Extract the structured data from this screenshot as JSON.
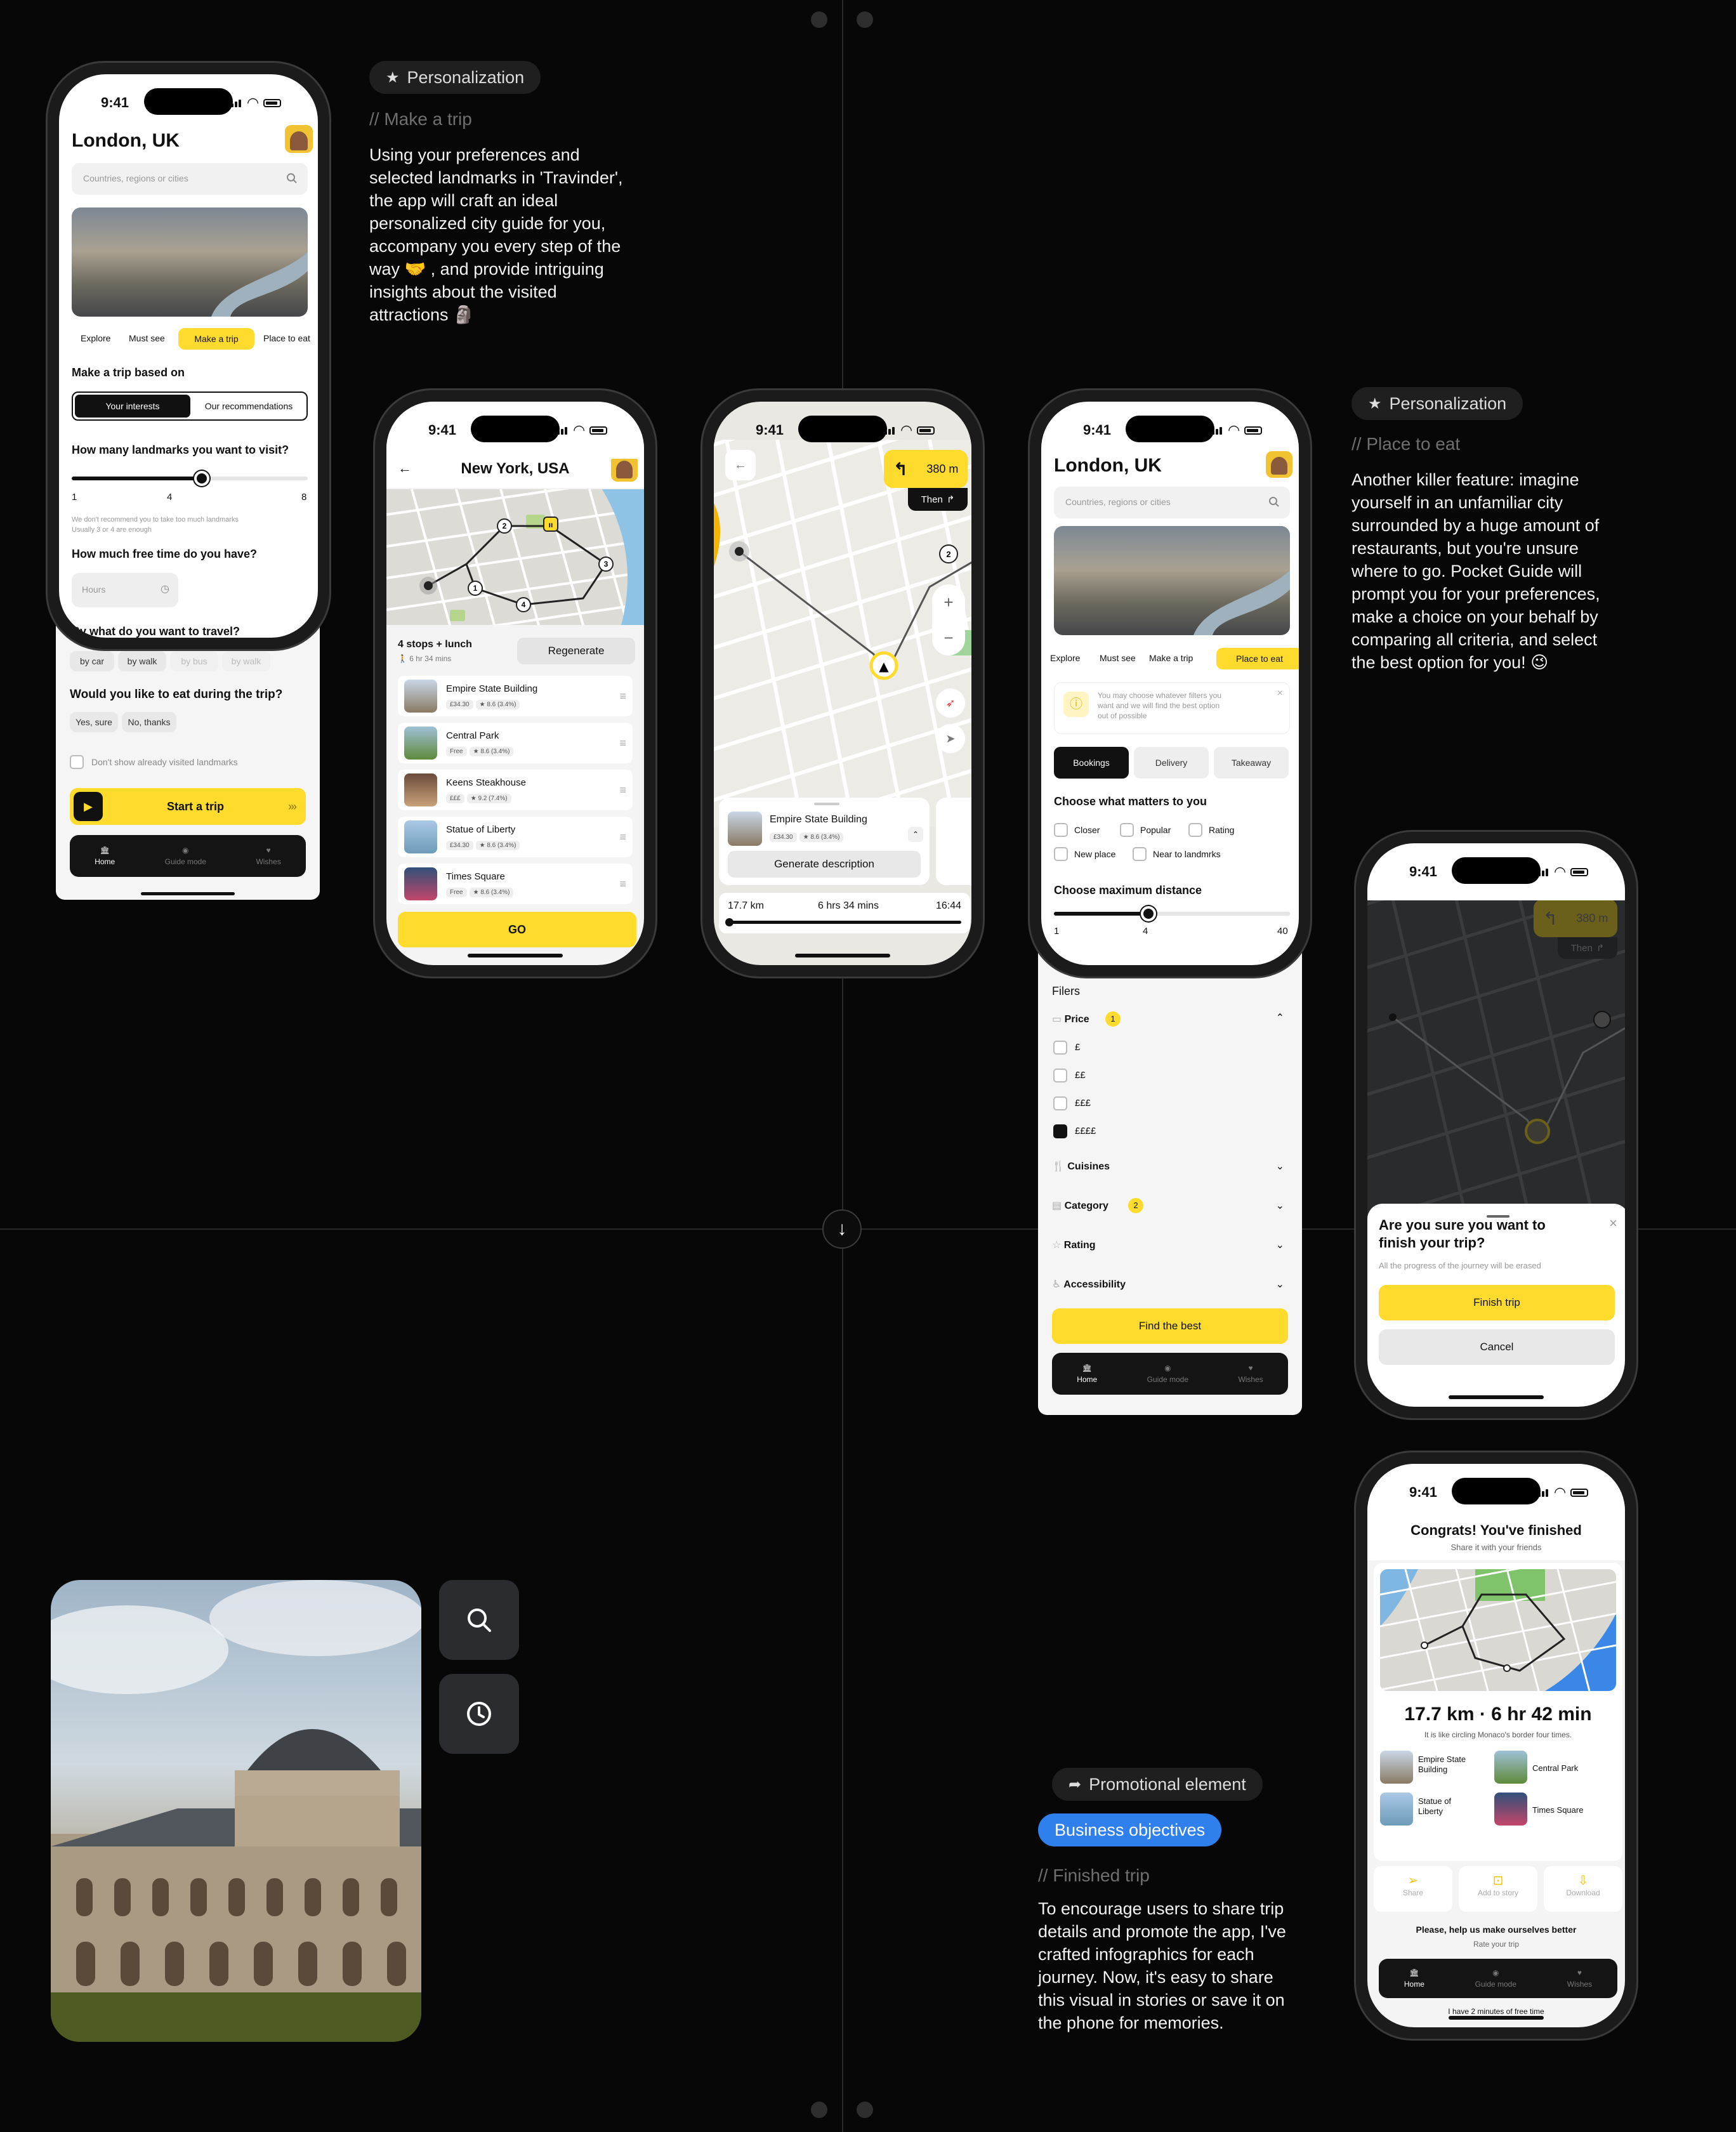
{
  "colors": {
    "accent": "#fedb2d",
    "blue": "#2f80ed",
    "bg": "#070707"
  },
  "left_text": {
    "tag": "Personalization",
    "comment": "// Make a trip",
    "desc": "Using your preferences and\nselected landmarks in 'Travinder',\nthe app will craft an ideal\npersonalized city guide for you,\naccompany you every step of the\nway 🤝 , and provide intriguing\ninsights about the visited\nattractions 🗿"
  },
  "right_text": {
    "tag": "Personalization",
    "comment": "// Place to eat",
    "desc": "Another killer feature: imagine\nyourself in an unfamiliar city\nsurrounded by a huge amount of\nrestaurants, but you're unsure\nwhere to go. Pocket Guide will\nprompt you for your preferences,\nmake a choice on your behalf by\ncomparing all criteria, and select\nthe best option for you! 😉"
  },
  "promo_text": {
    "tag": "Promotional element",
    "pill": "Business objectives",
    "comment": "// Finished trip",
    "desc": "To encourage users to share trip\ndetails and promote the app, I've\ncrafted infographics for each\njourney. Now, it's easy to share\nthis visual in stories or save it on\nthe phone for memories."
  },
  "status": {
    "time": "9:41"
  },
  "phone1": {
    "city": "London, UK",
    "search_placeholder": "Countries, regions or cities",
    "tabs": [
      "Explore",
      "Must see",
      "Make a trip",
      "Place to eat"
    ],
    "based_on": "Make a trip based on",
    "seg": [
      "Your interests",
      "Our recommendations"
    ],
    "landmarks_q": "How many landmarks you want to visit?",
    "slider": {
      "min": "1",
      "value": "4",
      "max": "8",
      "value_num": 4,
      "min_num": 1,
      "max_num": 8
    },
    "hint": "We don't recommend you to take too much landmarks\nUsually 3 or 4 are enough",
    "time_q": "How much free time do you have?",
    "hours_ph": "Hours",
    "travel_q": "By what do you want to travel?",
    "travel": [
      "by car",
      "by walk",
      "by bus",
      "by walk"
    ],
    "eat_q": "Would you like to eat during the trip?",
    "eat": [
      "Yes, sure",
      "No, thanks"
    ],
    "dont_show": "Don't show already visited landmarks",
    "start": "Start a trip",
    "nav": [
      "Home",
      "Guide mode",
      "Wishes"
    ]
  },
  "phone2": {
    "city": "New York, USA",
    "stops": "4 stops + lunch",
    "duration": "6 hr 34 mins",
    "regenerate": "Regenerate",
    "items": [
      {
        "name": "Empire State Building",
        "price": "£34.30",
        "rating": "8.6 (3.4%)"
      },
      {
        "name": "Central Park",
        "price": "Free",
        "rating": "8.6 (3.4%)"
      },
      {
        "name": "Keens Steakhouse",
        "price": "£££",
        "rating": "9.2 (7.4%)"
      },
      {
        "name": "Statue of Liberty",
        "price": "£34.30",
        "rating": "8.6 (3.4%)"
      },
      {
        "name": "Times Square",
        "price": "Free",
        "rating": "8.6 (3.4%)"
      }
    ],
    "go": "GO"
  },
  "phone3": {
    "distance_next": "380 m",
    "then": "Then",
    "card_title": "Empire State Building",
    "price": "£34.30",
    "rating": "8.6 (3.4%)",
    "generate": "Generate description",
    "total_km": "17.7 km",
    "total_time": "6 hrs 34 mins",
    "arrival": "16:44"
  },
  "phone4": {
    "city": "London, UK",
    "search_placeholder": "Countries, regions or cities",
    "tabs": [
      "Explore",
      "Must see",
      "Make a trip",
      "Place to eat"
    ],
    "info": "You may choose whatever filters you\nwant and we will find the best option\nout of possible",
    "modes": [
      "Bookings",
      "Delivery",
      "Takeaway"
    ],
    "matters": "Choose what matters to you",
    "opts": [
      "Closer",
      "Popular",
      "Rating",
      "New place",
      "Near to landmrks"
    ],
    "max_dist": "Choose maximum distance",
    "slider": {
      "min": "1",
      "value": "4",
      "max": "40",
      "value_num": 4,
      "min_num": 1,
      "max_num": 40
    },
    "filters": "Filers",
    "price": "Price",
    "price_count": "1",
    "price_opts": [
      "£",
      "££",
      "£££",
      "££££"
    ],
    "cuisines": "Cuisines",
    "category": "Category",
    "category_count": "2",
    "rating": "Rating",
    "accessibility": "Accessibility",
    "find": "Find the best",
    "nav": [
      "Home",
      "Guide mode",
      "Wishes"
    ]
  },
  "phone5": {
    "distance_next": "380 m",
    "then": "Then",
    "title": "Are you sure you want to\nfinish your trip?",
    "sub": "All the progress of the journey will be erased",
    "finish": "Finish trip",
    "cancel": "Cancel"
  },
  "phone6": {
    "title": "Congrats! You've finished",
    "sub": "Share it with your friends",
    "km": "17.7 km",
    "time": "6 hr 42 min",
    "compare": "It is like circling Monaco's border four times.",
    "places": [
      "Empire State\nBuilding",
      "Central Park",
      "Statue of\nLiberty",
      "Times Square"
    ],
    "actions": [
      "Share",
      "Add to story",
      "Download"
    ],
    "help": "Please, help us make ourselves better",
    "rate": "Rate your trip",
    "nav": [
      "Home",
      "Guide mode",
      "Wishes"
    ],
    "footer": "I have 2 minutes of free time"
  }
}
